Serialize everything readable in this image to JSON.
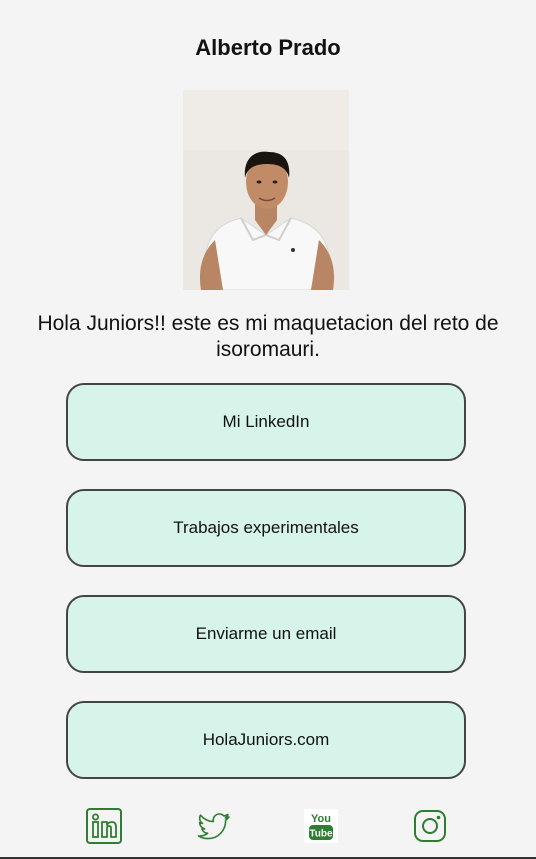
{
  "profile": {
    "name": "Alberto Prado",
    "bio": "Hola Juniors!! este es mi maquetacion del reto de isoromauri."
  },
  "links": [
    {
      "label": "Mi LinkedIn"
    },
    {
      "label": "Trabajos experimentales"
    },
    {
      "label": "Enviarme un email"
    },
    {
      "label": "HolaJuniors.com"
    }
  ],
  "social": [
    {
      "icon": "linkedin-icon"
    },
    {
      "icon": "twitter-icon"
    },
    {
      "icon": "youtube-icon",
      "text_top": "You",
      "text_bottom": "Tube"
    },
    {
      "icon": "instagram-icon"
    }
  ],
  "colors": {
    "background": "#f4f4f4",
    "button_fill": "#d7f4eb",
    "button_border": "#444444",
    "social_green": "#2e7d32"
  }
}
